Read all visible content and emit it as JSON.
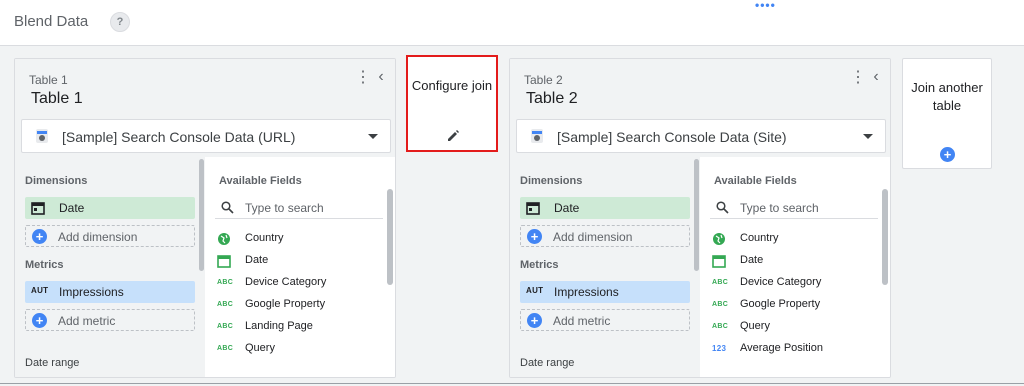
{
  "header": {
    "title": "Blend Data",
    "help_icon": "?",
    "more_icon": "••••"
  },
  "configure_join": {
    "label": "Configure join",
    "icon": "pencil-icon"
  },
  "join_another": {
    "label": "Join another table",
    "icon": "plus-icon"
  },
  "tables": [
    {
      "small_name": "Table 1",
      "name": "Table 1",
      "data_source": "[Sample] Search Console Data (URL)",
      "dimensions_title": "Dimensions",
      "dimensions": [
        {
          "label": "Date",
          "icon": "calendar-icon"
        }
      ],
      "add_dimension": "Add dimension",
      "metrics_title": "Metrics",
      "metrics": [
        {
          "label": "Impressions",
          "badge": "AUT"
        }
      ],
      "add_metric": "Add metric",
      "date_range_title": "Date range",
      "available_title": "Available Fields",
      "search_placeholder": "Type to search",
      "fields": [
        {
          "label": "Country",
          "type": "geo"
        },
        {
          "label": "Date",
          "type": "date"
        },
        {
          "label": "Device Category",
          "type": "text",
          "badge": "ABC"
        },
        {
          "label": "Google Property",
          "type": "text",
          "badge": "ABC"
        },
        {
          "label": "Landing Page",
          "type": "text",
          "badge": "ABC"
        },
        {
          "label": "Query",
          "type": "text",
          "badge": "ABC"
        }
      ]
    },
    {
      "small_name": "Table 2",
      "name": "Table 2",
      "data_source": "[Sample] Search Console Data (Site)",
      "dimensions_title": "Dimensions",
      "dimensions": [
        {
          "label": "Date",
          "icon": "calendar-icon"
        }
      ],
      "add_dimension": "Add dimension",
      "metrics_title": "Metrics",
      "metrics": [
        {
          "label": "Impressions",
          "badge": "AUT"
        }
      ],
      "add_metric": "Add metric",
      "date_range_title": "Date range",
      "available_title": "Available Fields",
      "search_placeholder": "Type to search",
      "fields": [
        {
          "label": "Country",
          "type": "geo"
        },
        {
          "label": "Date",
          "type": "date"
        },
        {
          "label": "Device Category",
          "type": "text",
          "badge": "ABC"
        },
        {
          "label": "Google Property",
          "type": "text",
          "badge": "ABC"
        },
        {
          "label": "Query",
          "type": "text",
          "badge": "ABC"
        },
        {
          "label": "Average Position",
          "type": "number",
          "badge": "123"
        }
      ]
    }
  ],
  "colors": {
    "accent": "#4285f4",
    "dimension_chip": "#ceead6",
    "metric_chip": "#c6e0fb",
    "highlight_border": "#e31b1b"
  }
}
